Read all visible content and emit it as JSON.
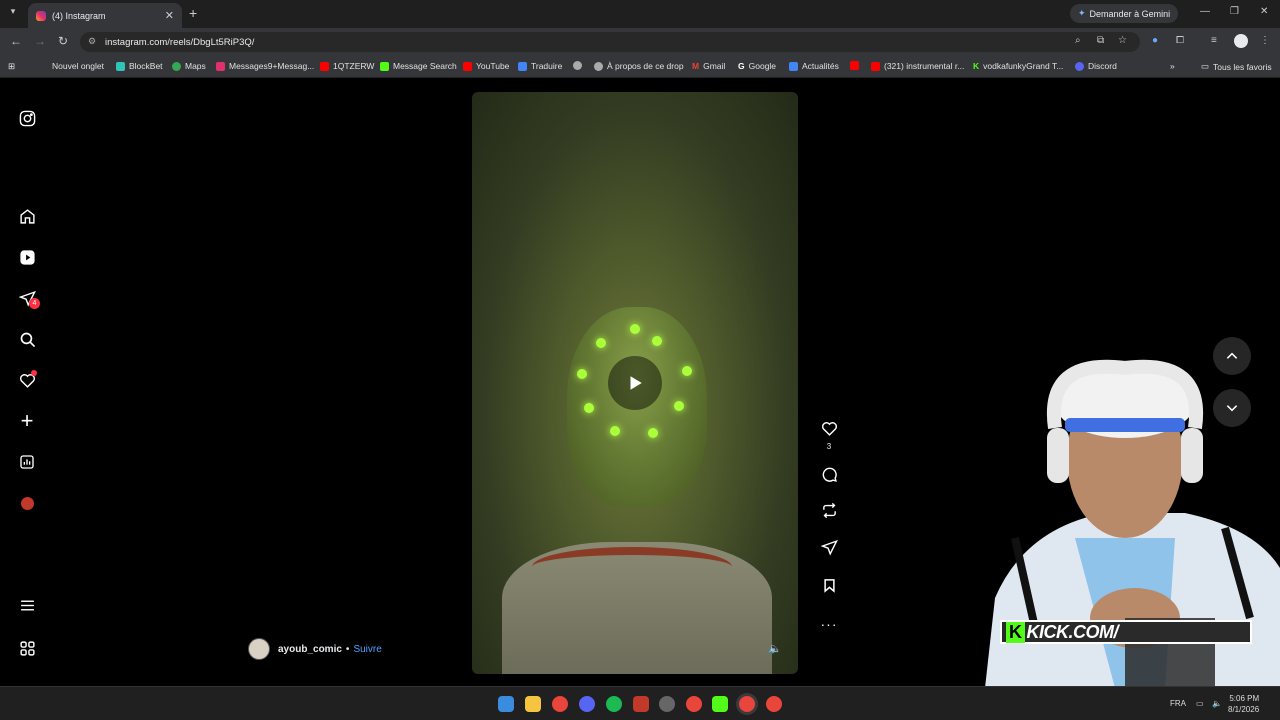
{
  "browser": {
    "tab_title": "(4) Instagram",
    "url": "instagram.com/reels/DbgLt5RiP3Q/",
    "gemini_label": "Demander à Gemini",
    "bookmarks": [
      "Nouvel onglet",
      "BlockBet",
      "Maps",
      "Messages9+Messag...",
      "1QTZERW",
      "Message Search",
      "YouTube",
      "Traduire",
      "",
      "À propos de ce drop",
      "Gmail",
      "Google",
      "Actualités",
      "",
      "(321) instrumental r...",
      "vodkafunkyGrand T...",
      "Discord"
    ],
    "all_bookmarks": "Tous les favoris"
  },
  "instagram": {
    "notifications_badge": "4",
    "reel": {
      "author": "ayoub_comic",
      "separator": "•",
      "follow_label": "Suivre",
      "like_count": "3"
    }
  },
  "overlay": {
    "kick_channel": "KICK.COM/"
  },
  "taskbar": {
    "language": "FRA",
    "time": "5:06 PM",
    "date": "8/1/2026"
  }
}
